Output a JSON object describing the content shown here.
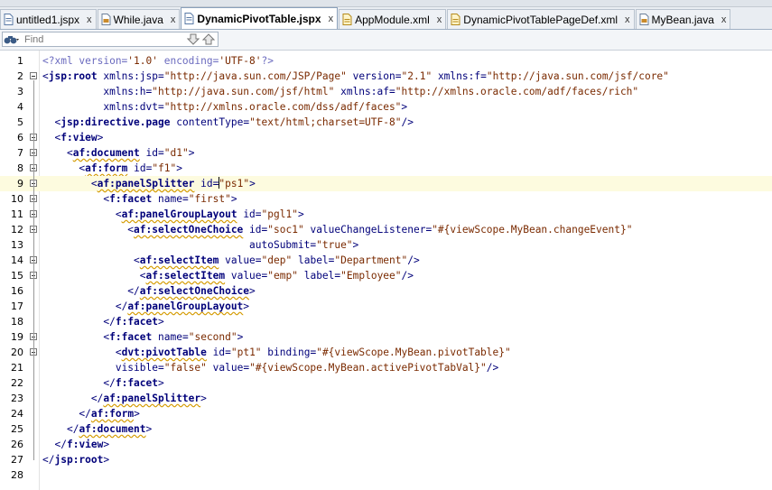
{
  "tabs": [
    {
      "label": "untitled1.jspx",
      "icon": "jspx-file-icon",
      "active": false
    },
    {
      "label": "While.java",
      "icon": "java-file-icon",
      "active": false
    },
    {
      "label": "DynamicPivotTable.jspx",
      "icon": "jspx-file-icon",
      "active": true
    },
    {
      "label": "AppModule.xml",
      "icon": "xml-file-icon",
      "active": false
    },
    {
      "label": "DynamicPivotTablePageDef.xml",
      "icon": "xml-file-icon",
      "active": false
    },
    {
      "label": "MyBean.java",
      "icon": "java-file-icon",
      "active": false
    }
  ],
  "close_glyph": "x",
  "find": {
    "placeholder": "Find"
  },
  "editor": {
    "current_line": 9,
    "lines": [
      {
        "n": "1",
        "text": "<?xml version='1.0' encoding='UTF-8'?>"
      },
      {
        "n": "2",
        "text": "<jsp:root xmlns:jsp=\"http://java.sun.com/JSP/Page\" version=\"2.1\" xmlns:f=\"http://java.sun.com/jsf/core\""
      },
      {
        "n": "3",
        "text": "          xmlns:h=\"http://java.sun.com/jsf/html\" xmlns:af=\"http://xmlns.oracle.com/adf/faces/rich\""
      },
      {
        "n": "4",
        "text": "          xmlns:dvt=\"http://xmlns.oracle.com/dss/adf/faces\">"
      },
      {
        "n": "5",
        "text": "  <jsp:directive.page contentType=\"text/html;charset=UTF-8\"/>"
      },
      {
        "n": "6",
        "text": "  <f:view>"
      },
      {
        "n": "7",
        "text": "    <af:document id=\"d1\">"
      },
      {
        "n": "8",
        "text": "      <af:form id=\"f1\">"
      },
      {
        "n": "9",
        "text": "        <af:panelSplitter id=\"ps1\">"
      },
      {
        "n": "10",
        "text": "          <f:facet name=\"first\">"
      },
      {
        "n": "11",
        "text": "            <af:panelGroupLayout id=\"pgl1\">"
      },
      {
        "n": "12",
        "text": "              <af:selectOneChoice id=\"soc1\" valueChangeListener=\"#{viewScope.MyBean.changeEvent}\""
      },
      {
        "n": "13",
        "text": "                                  autoSubmit=\"true\">"
      },
      {
        "n": "14",
        "text": "               <af:selectItem value=\"dep\" label=\"Department\"/>"
      },
      {
        "n": "15",
        "text": "                <af:selectItem value=\"emp\" label=\"Employee\"/>"
      },
      {
        "n": "16",
        "text": "              </af:selectOneChoice>"
      },
      {
        "n": "17",
        "text": "            </af:panelGroupLayout>"
      },
      {
        "n": "18",
        "text": "          </f:facet>"
      },
      {
        "n": "19",
        "text": "          <f:facet name=\"second\">"
      },
      {
        "n": "20",
        "text": "            <dvt:pivotTable id=\"pt1\" binding=\"#{viewScope.MyBean.pivotTable}\""
      },
      {
        "n": "21",
        "text": "            visible=\"false\" value=\"#{viewScope.MyBean.activePivotTabVal}\"/>"
      },
      {
        "n": "22",
        "text": "          </f:facet>"
      },
      {
        "n": "23",
        "text": "        </af:panelSplitter>"
      },
      {
        "n": "24",
        "text": "      </af:form>"
      },
      {
        "n": "25",
        "text": "    </af:document>"
      },
      {
        "n": "26",
        "text": "  </f:view>"
      },
      {
        "n": "27",
        "text": "</jsp:root>"
      },
      {
        "n": "28",
        "text": ""
      }
    ],
    "fold_lines": [
      2,
      6,
      7,
      8,
      9,
      10,
      11,
      12,
      14,
      15,
      19,
      20
    ],
    "squiggle_words": [
      "af:document",
      "af:form",
      "af:panelSplitter",
      "af:panelGroupLayout",
      "af:selectOneChoice",
      "af:selectItem",
      "dvt:pivotTable"
    ]
  },
  "colors": {
    "tag": "#00007a",
    "value": "#7a2a00",
    "pi": "#6b6bbf",
    "current_line": "#fdfbdf"
  }
}
